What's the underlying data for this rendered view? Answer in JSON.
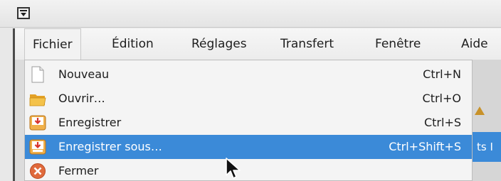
{
  "window": {
    "menu_button_icon": "window-menu-icon"
  },
  "menubar": {
    "items": [
      {
        "label": "Fichier"
      },
      {
        "label": "Édition"
      },
      {
        "label": "Réglages"
      },
      {
        "label": "Transfert"
      },
      {
        "label": "Fenêtre"
      },
      {
        "label": "Aide"
      }
    ],
    "active_index": 0
  },
  "dropdown": {
    "items": [
      {
        "label": "Nouveau",
        "shortcut": "Ctrl+N",
        "icon": "new-document-icon"
      },
      {
        "label": "Ouvrir…",
        "shortcut": "Ctrl+O",
        "icon": "open-folder-icon"
      },
      {
        "label": "Enregistrer",
        "shortcut": "Ctrl+S",
        "icon": "save-icon"
      },
      {
        "label": "Enregistrer sous…",
        "shortcut": "Ctrl+Shift+S",
        "icon": "save-as-icon",
        "highlighted": true
      },
      {
        "label": "Fermer",
        "shortcut": "",
        "icon": "close-icon"
      }
    ]
  },
  "background_peek": {
    "partial_text": "ts I"
  },
  "colors": {
    "highlight": "#3b8ad8",
    "menu_bg": "#f4f4f4"
  }
}
